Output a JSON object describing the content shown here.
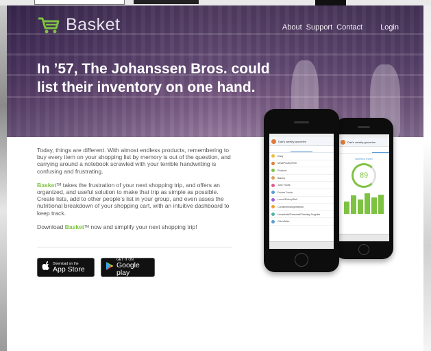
{
  "brand": {
    "name": "Basket",
    "accent_color": "#7ec242",
    "logo_icon": "shopping-cart-icon"
  },
  "nav": {
    "about": "About",
    "support": "Support",
    "contact": "Contact",
    "login": "Login"
  },
  "hero": {
    "headline": "In ’57, The Johanssen Bros. could list their inventory on one hand."
  },
  "copy": {
    "p1": "Today, things are different.  With almost endless products, remembering to buy every item on your shopping list by memory is out of the question, and carrying around a notebook scrawled with your terrible handwriting is confusing and frustrating.",
    "p2_brand": "Basket",
    "tm": "TM",
    "p2": " takes the frustration of your next shopping trip, and offers an organized, and useful solution to make that trip as simple as possible. Create lists, add to other people’s list in your group, and even asses the nutritional breakdown of your shopping cart, with an intuitive dashboard to keep track.",
    "p3_pre": "Download ",
    "p3_brand": "Basket",
    "p3_post": " now and simplify your next shopping trip!"
  },
  "badges": {
    "apple_small": "Download on the",
    "apple_big": "App Store",
    "google_small": "GET IT ON",
    "google_big": "Google play"
  },
  "phone_front": {
    "header": "Dad's weekly groceries",
    "items": [
      {
        "label": "Dairy",
        "color": "#f0c040"
      },
      {
        "label": "Meat/Poultry/Fish",
        "color": "#e07b39"
      },
      {
        "label": "Produce",
        "color": "#7ec242"
      },
      {
        "label": "Bakery",
        "color": "#d9a05b"
      },
      {
        "label": "Junk Foods",
        "color": "#e05a8a"
      },
      {
        "label": "Frozen Foods",
        "color": "#5b9bd5"
      },
      {
        "label": "Lunch/Pickup/Deli",
        "color": "#a05bd5"
      },
      {
        "label": "Condiments/Ingredients",
        "color": "#f0a030"
      },
      {
        "label": "Household/Personal/Cleaning Supplies",
        "color": "#50b0a0"
      },
      {
        "label": "Other/Misc",
        "color": "#5b9bd5"
      }
    ]
  },
  "phone_back": {
    "header": "Dad's weekly groceries",
    "dash_title": "Nutrition Index",
    "score": "89",
    "bars": [
      0.6,
      0.9,
      0.7,
      1.0,
      0.8,
      0.95
    ]
  }
}
